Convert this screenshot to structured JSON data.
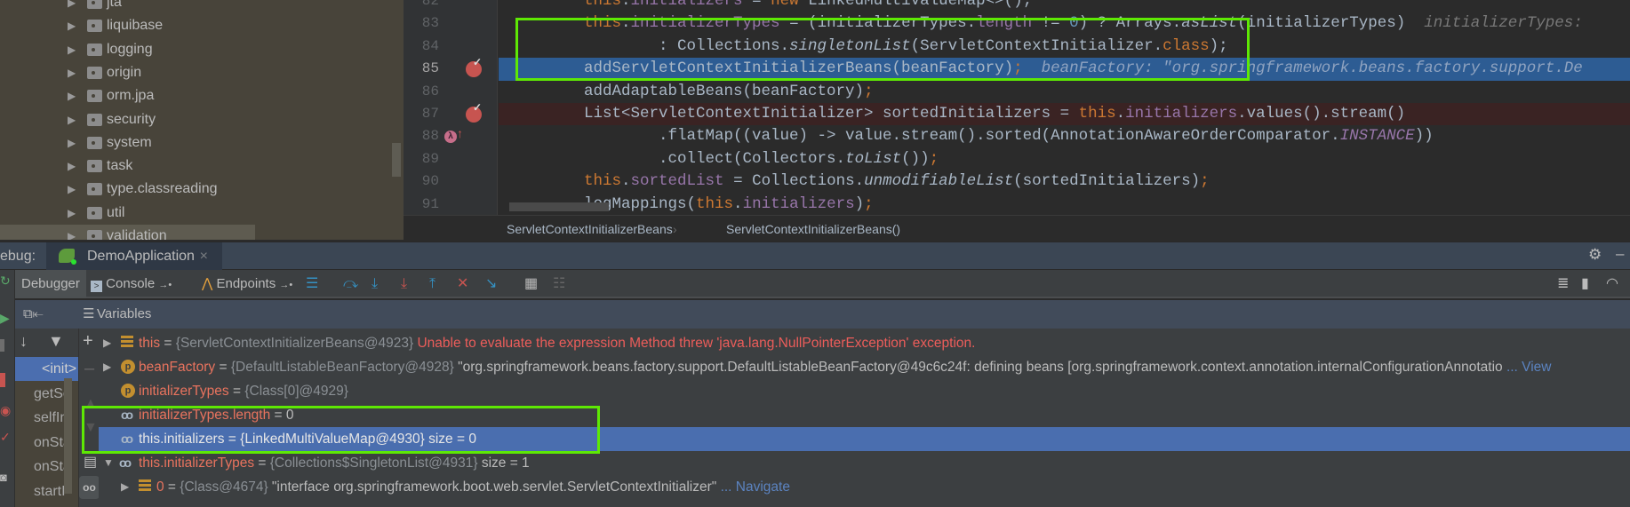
{
  "project_tree": {
    "items": [
      {
        "label": "jta"
      },
      {
        "label": "liquibase"
      },
      {
        "label": "logging"
      },
      {
        "label": "origin"
      },
      {
        "label": "orm.jpa"
      },
      {
        "label": "security"
      },
      {
        "label": "system"
      },
      {
        "label": "task"
      },
      {
        "label": "type.classreading"
      },
      {
        "label": "util"
      },
      {
        "label": "validation"
      }
    ]
  },
  "editor": {
    "current_line": 85,
    "lines": [
      {
        "n": "82",
        "tokens": [
          [
            "this",
            "kw"
          ],
          [
            ".",
            ""
          ],
          [
            "initializers",
            "field"
          ],
          [
            " = ",
            ""
          ],
          [
            "new ",
            "kw"
          ],
          [
            "LinkedMultiValueMap<>();",
            ""
          ]
        ]
      },
      {
        "n": "83",
        "tokens": [
          [
            "this",
            "kw"
          ],
          [
            ".",
            ""
          ],
          [
            "initializerTypes",
            "field"
          ],
          [
            " = (initializerTypes.",
            ""
          ],
          [
            "length",
            "field"
          ],
          [
            " != ",
            ""
          ],
          [
            "0",
            "num"
          ],
          [
            ") ? Arrays.",
            ""
          ],
          [
            "asList",
            "it"
          ],
          [
            "(initializerTypes)  ",
            ""
          ],
          [
            "initializerTypes: ",
            "hint"
          ]
        ]
      },
      {
        "n": "84",
        "tokens": [
          [
            "        : Collections.",
            ""
          ],
          [
            "singletonList",
            "it"
          ],
          [
            "(ServletContextInitializer.",
            ""
          ],
          [
            "class",
            "kw"
          ],
          [
            ");",
            ""
          ]
        ]
      },
      {
        "n": "85",
        "tokens": [
          [
            "addServletContextInitializerBeans(beanFactory)",
            ""
          ],
          [
            ";",
            "kw"
          ],
          [
            "  beanFactory: \"org.springframework.beans.factory.support.De",
            "hint"
          ]
        ]
      },
      {
        "n": "86",
        "tokens": [
          [
            "addAdaptableBeans(beanFactory)",
            ""
          ],
          [
            ";",
            "kw"
          ]
        ]
      },
      {
        "n": "87",
        "tokens": [
          [
            "List<ServletContextInitializer> sortedInitializers = ",
            ""
          ],
          [
            "this",
            "kw"
          ],
          [
            ".",
            ""
          ],
          [
            "initializers",
            "field"
          ],
          [
            ".values().stream()",
            ""
          ]
        ]
      },
      {
        "n": "88",
        "tokens": [
          [
            "        .flatMap((value) -> value.stream().sorted(AnnotationAwareOrderComparator.",
            ""
          ],
          [
            "INSTANCE",
            "itf"
          ],
          [
            "))",
            ""
          ]
        ]
      },
      {
        "n": "89",
        "tokens": [
          [
            "        .collect(Collectors.",
            ""
          ],
          [
            "toList",
            "it"
          ],
          [
            "())",
            ""
          ],
          [
            ";",
            "kw"
          ]
        ]
      },
      {
        "n": "90",
        "tokens": [
          [
            "this",
            "kw"
          ],
          [
            ".",
            ""
          ],
          [
            "sortedList",
            "field"
          ],
          [
            " = Collections.",
            ""
          ],
          [
            "unmodifiableList",
            "it"
          ],
          [
            "(sortedInitializers)",
            ""
          ],
          [
            ";",
            "kw"
          ]
        ]
      },
      {
        "n": "91",
        "tokens": [
          [
            "logMappings(",
            ""
          ],
          [
            "this",
            "kw"
          ],
          [
            ".",
            ""
          ],
          [
            "initializers",
            "field"
          ],
          [
            ")",
            ""
          ],
          [
            ";",
            "kw"
          ]
        ]
      }
    ],
    "breakpoint_lines": [
      "85",
      "87"
    ],
    "lambda_breakpoint_line": "88",
    "lambda_symbol": "λ",
    "breadcrumbs": [
      "ServletContextInitializerBeans",
      "ServletContextInitializerBeans()"
    ],
    "breadcrumb_separator": "›"
  },
  "debug": {
    "label": "ebug:",
    "app_tab": "DemoApplication",
    "close_glyph": "×",
    "tabs": {
      "debugger": "Debugger",
      "console": "Console",
      "endpoints": "Endpoints"
    },
    "variables_title": "Variables",
    "frames": [
      "<init>",
      "getSe",
      "selfIni",
      "onSta",
      "onSta",
      "startI"
    ],
    "variables": [
      {
        "name": "this",
        "eq": " = ",
        "type": "{ServletContextInitializerBeans@4923}",
        "value": "",
        "error": " Unable to evaluate the expression Method threw 'java.lang.NullPointerException' exception.",
        "link": ""
      },
      {
        "name": "beanFactory",
        "eq": " = ",
        "type": "{DefaultListableBeanFactory@4928}",
        "value": " \"org.springframework.beans.factory.support.DefaultListableBeanFactory@49c6c24f: defining beans [org.springframework.context.annotation.internalConfigurationAnnotatio",
        "error": "",
        "link": " ... View"
      },
      {
        "name": "initializerTypes",
        "eq": " = ",
        "type": "{Class[0]@4929}",
        "value": "",
        "error": "",
        "link": ""
      },
      {
        "name": "initializerTypes.length",
        "eq": " = ",
        "type": "",
        "value": "0",
        "error": "",
        "link": ""
      },
      {
        "name": "this.initializers",
        "eq": " = ",
        "type": "{LinkedMultiValueMap@4930}",
        "value": "  size = 0",
        "error": "",
        "link": ""
      },
      {
        "name": "this.initializerTypes",
        "eq": " = ",
        "type": "{Collections$SingletonList@4931}",
        "value": "  size = 1",
        "error": "",
        "link": ""
      },
      {
        "name": "0",
        "eq": " = ",
        "type": "{Class@4674}",
        "value": " \"interface org.springframework.boot.web.servlet.ServletContextInitializer\"",
        "error": "",
        "link": " ... Navigate"
      }
    ]
  },
  "colors": {
    "highlight_box": "#5ee804",
    "selection": "#4a6eaf",
    "breakpoint": "#c75450"
  }
}
